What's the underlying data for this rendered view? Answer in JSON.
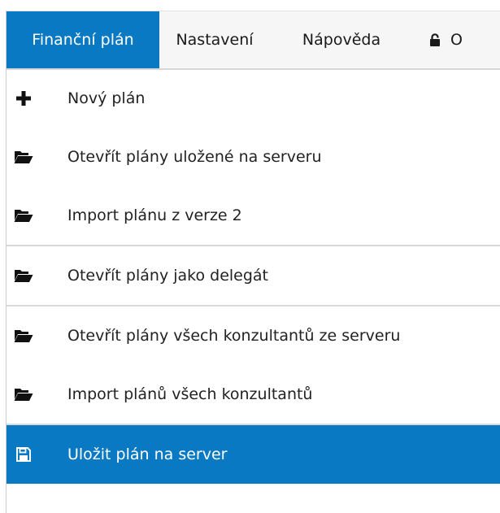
{
  "menubar": {
    "tabs": [
      {
        "label": "Finanční plán",
        "active": true
      },
      {
        "label": "Nastavení"
      },
      {
        "label": "Nápověda"
      },
      {
        "label": "O",
        "icon": "lock-icon"
      }
    ]
  },
  "menu": {
    "items": [
      {
        "label": "Nový plán",
        "icon": "plus-icon"
      },
      {
        "label": "Otevřít plány uložené na serveru",
        "icon": "folder-open-icon"
      },
      {
        "label": "Import plánu z verze 2",
        "icon": "folder-open-icon"
      },
      {
        "label": "Otevřít plány jako delegát",
        "icon": "folder-open-icon"
      },
      {
        "label": "Otevřít plány všech konzultantů ze serveru",
        "icon": "folder-open-icon"
      },
      {
        "label": "Import plánů všech konzultantů",
        "icon": "folder-open-icon"
      },
      {
        "label": "Uložit plán na server",
        "icon": "save-icon",
        "highlighted": true
      }
    ]
  },
  "colors": {
    "accent": "#0a79c4",
    "menubar_bg": "#f6f6f6",
    "separator": "#d9d9d9"
  }
}
